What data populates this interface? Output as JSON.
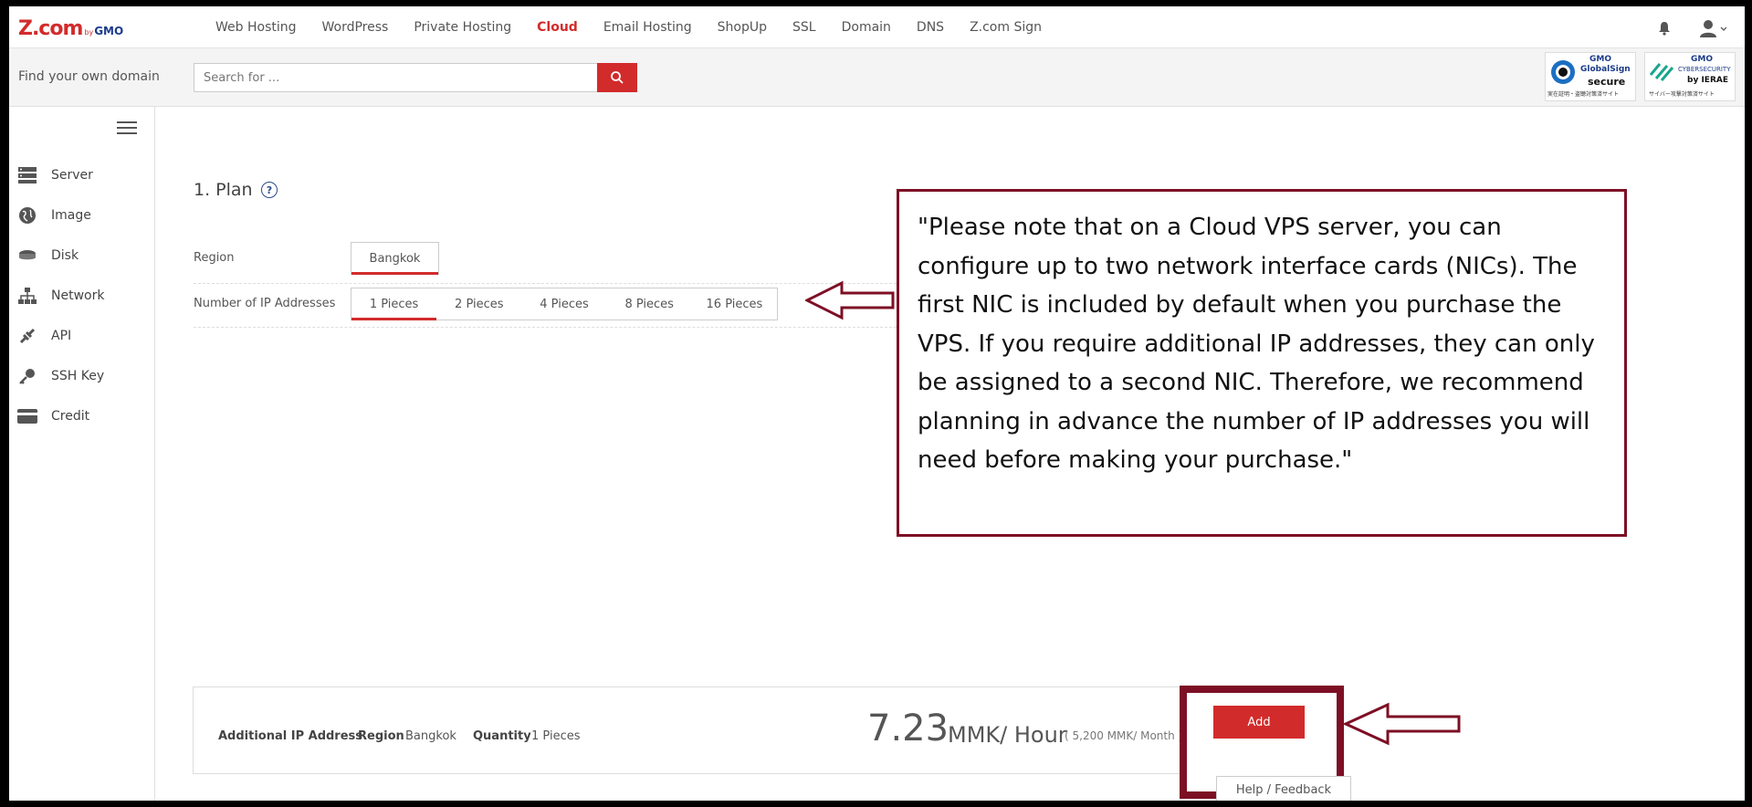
{
  "brand": {
    "name": "Z.com",
    "by": "by",
    "gmo": "GMO",
    "accent": "#d22b2b",
    "annotation_color": "#7d0f25"
  },
  "nav": {
    "links": [
      "Web Hosting",
      "WordPress",
      "Private Hosting",
      "Cloud",
      "Email Hosting",
      "ShopUp",
      "SSL",
      "Domain",
      "DNS",
      "Z.com Sign"
    ],
    "active": "Cloud",
    "icons": [
      "bell-icon",
      "user-icon"
    ]
  },
  "domain": {
    "label": "Find your own domain",
    "search_placeholder": "Search for ...",
    "badges": [
      {
        "top": "GMO",
        "mid": "GlobalSign",
        "bottom": "secure",
        "foot": "実在証明・盗聴対策済サイト"
      },
      {
        "top": "GMO",
        "mid": "CYBERSECURITY",
        "bottom": "by IERAE",
        "foot": "サイバー攻撃対策済サイト"
      }
    ]
  },
  "sidebar": {
    "items": [
      {
        "label": "Server",
        "icon": "server-icon"
      },
      {
        "label": "Image",
        "icon": "globe-icon"
      },
      {
        "label": "Disk",
        "icon": "disk-icon"
      },
      {
        "label": "Network",
        "icon": "network-icon"
      },
      {
        "label": "API",
        "icon": "api-icon"
      },
      {
        "label": "SSH Key",
        "icon": "key-icon"
      },
      {
        "label": "Credit",
        "icon": "credit-card-icon"
      }
    ]
  },
  "plan": {
    "title": "1. Plan",
    "help": "?",
    "region_label": "Region",
    "region_options": [
      "Bangkok"
    ],
    "region_selected": "Bangkok",
    "ip_label": "Number of IP Addresses",
    "ip_options": [
      "1 Pieces",
      "2 Pieces",
      "4 Pieces",
      "8 Pieces",
      "16 Pieces"
    ],
    "ip_selected": "1 Pieces"
  },
  "note": {
    "text": " \"Please note that on a Cloud VPS server, you can configure up to two network interface cards (NICs). The first NIC is included by default when you purchase the VPS. If you require additional IP addresses, they can only be assigned to a second NIC. Therefore, we recommend planning in advance the number of IP addresses you will need before making your purchase.\""
  },
  "summary": {
    "item": "Additional IP Address",
    "region_label": "Region",
    "region_value": "Bangkok",
    "quantity_label": "Quantity",
    "quantity_value": "1  Pieces",
    "price": "7.23",
    "unit": "MMK/ Hour",
    "monthly": "( 5,200 MMK/ Month )",
    "add_label": "Add",
    "feedback_label": "Help / Feedback"
  }
}
